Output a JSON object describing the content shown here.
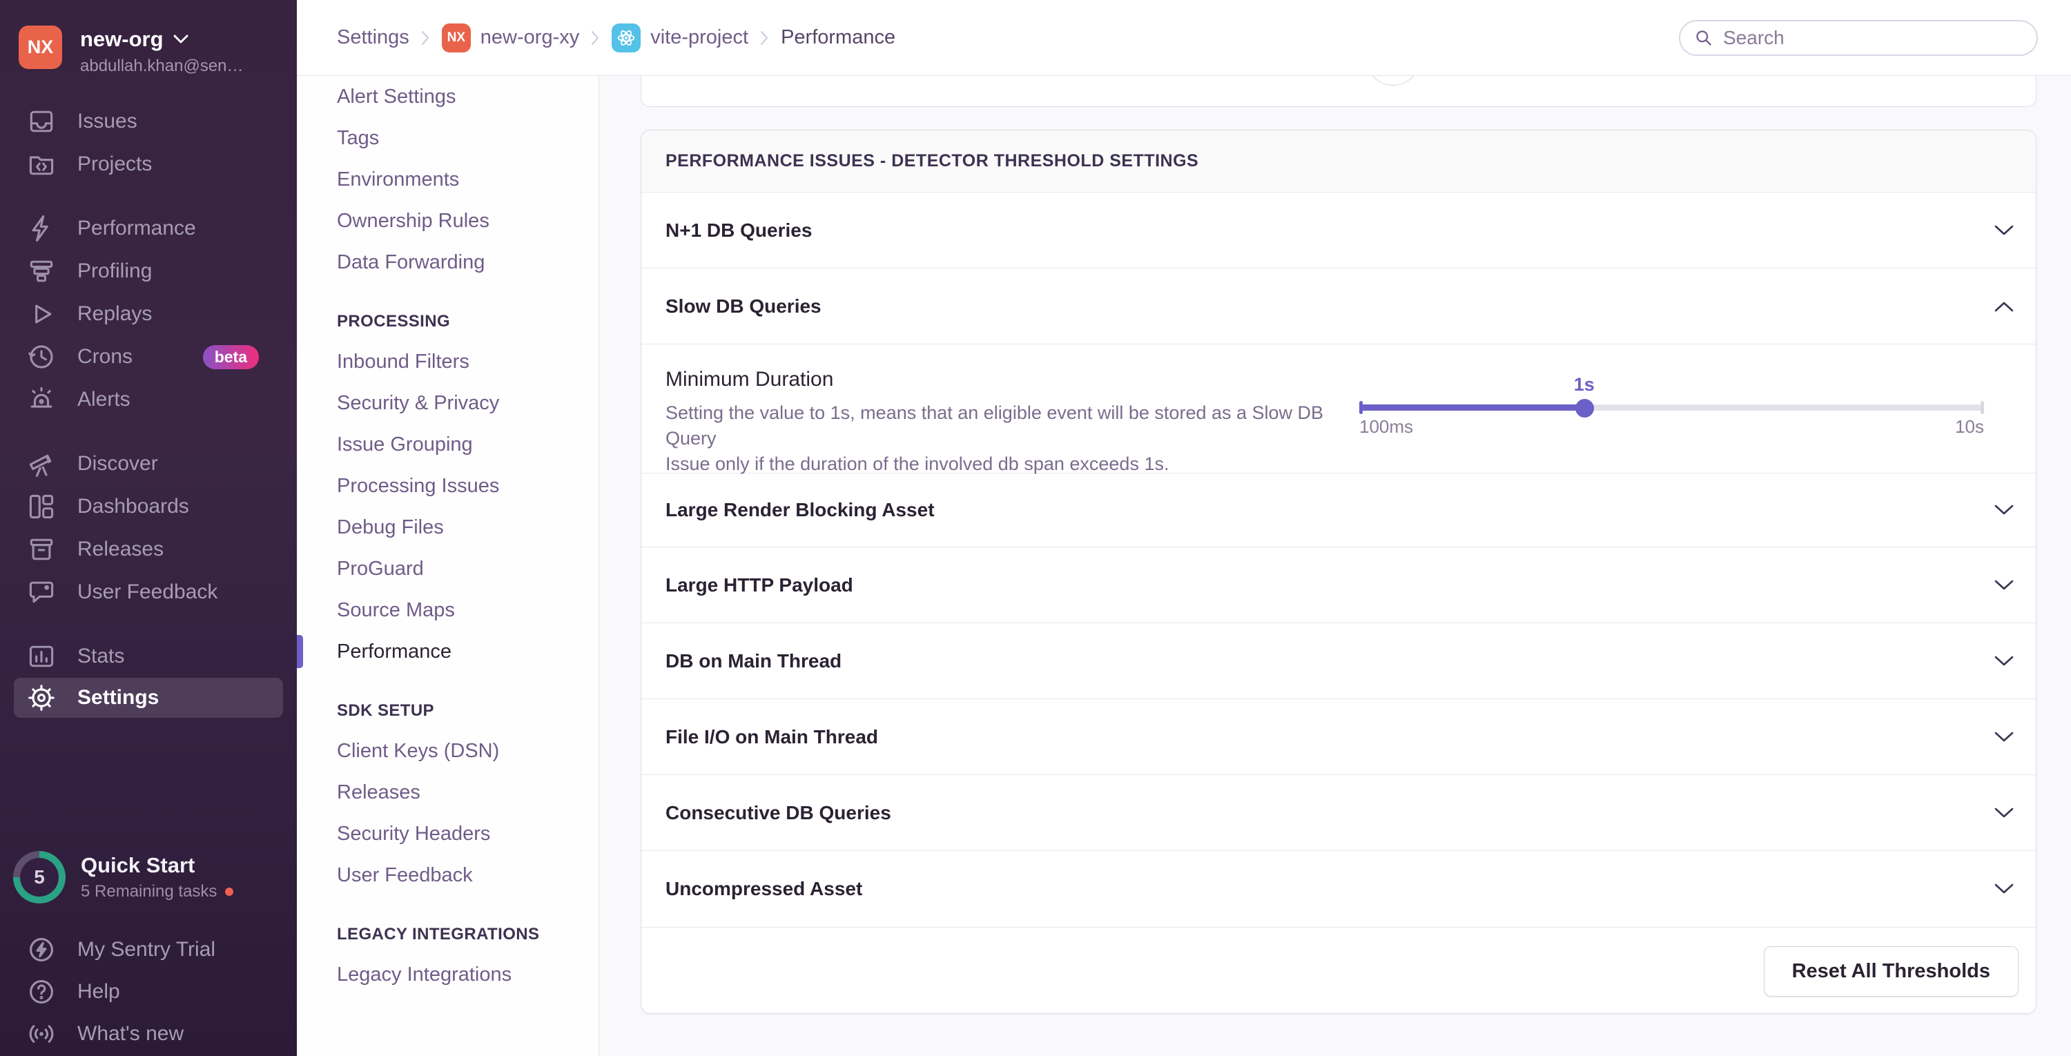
{
  "colors": {
    "accent": "#6C5FC7",
    "org_avatar": "#E9634B",
    "beta_gradient_start": "#8B52C5",
    "beta_gradient_end": "#ED2E7E",
    "quickstart_ring": "#2BA185",
    "tasks_dot": "#F0614E",
    "react_icon_bg": "#53C1E8",
    "sidebar_top": "#37223F",
    "sidebar_bottom": "#2C1B36"
  },
  "sidebar": {
    "org": {
      "initials": "NX",
      "name": "new-org",
      "email": "abdullah.khan@sen…"
    },
    "nav": {
      "issues": "Issues",
      "projects": "Projects",
      "performance": "Performance",
      "profiling": "Profiling",
      "replays": "Replays",
      "crons": "Crons",
      "crons_badge": "beta",
      "alerts": "Alerts",
      "discover": "Discover",
      "dashboards": "Dashboards",
      "releases": "Releases",
      "user_feedback": "User Feedback",
      "stats": "Stats",
      "settings": "Settings"
    },
    "quick_start": {
      "count": "5",
      "title": "Quick Start",
      "subtitle": "5 Remaining tasks"
    },
    "help_nav": {
      "trial": "My Sentry Trial",
      "help": "Help",
      "whats_new": "What's new"
    }
  },
  "header": {
    "breadcrumbs": {
      "settings": "Settings",
      "org_initials": "NX",
      "org": "new-org-xy",
      "project": "vite-project",
      "page": "Performance"
    },
    "search_placeholder": "Search"
  },
  "settings_nav": {
    "sections": [
      {
        "heading": "",
        "items": [
          "Alert Settings",
          "Tags",
          "Environments",
          "Ownership Rules",
          "Data Forwarding"
        ]
      },
      {
        "heading": "PROCESSING",
        "items": [
          "Inbound Filters",
          "Security & Privacy",
          "Issue Grouping",
          "Processing Issues",
          "Debug Files",
          "ProGuard",
          "Source Maps",
          "Performance"
        ],
        "active_item": "Performance"
      },
      {
        "heading": "SDK SETUP",
        "items": [
          "Client Keys (DSN)",
          "Releases",
          "Security Headers",
          "User Feedback"
        ]
      },
      {
        "heading": "LEGACY INTEGRATIONS",
        "items": [
          "Legacy Integrations"
        ]
      }
    ]
  },
  "main": {
    "panel_title": "PERFORMANCE ISSUES - DETECTOR THRESHOLD SETTINGS",
    "rows": {
      "n_plus_one": "N+1 DB Queries",
      "slow_db": "Slow DB Queries",
      "large_render": "Large Render Blocking Asset",
      "large_http": "Large HTTP Payload",
      "db_main": "DB on Main Thread",
      "file_io": "File I/O on Main Thread",
      "consecutive_db": "Consecutive DB Queries",
      "uncompressed": "Uncompressed Asset"
    },
    "expanded_row": "Slow DB Queries",
    "slow_db_detail": {
      "field_label": "Minimum Duration",
      "description_line1": "Setting the value to 1s, means that an eligible event will be stored as a Slow DB Query",
      "description_line2": "Issue only if the duration of the involved db span exceeds 1s.",
      "slider": {
        "value": "1s",
        "min": "100ms",
        "max": "10s",
        "percent": 36
      }
    },
    "footer": {
      "reset_button": "Reset All Thresholds"
    }
  }
}
